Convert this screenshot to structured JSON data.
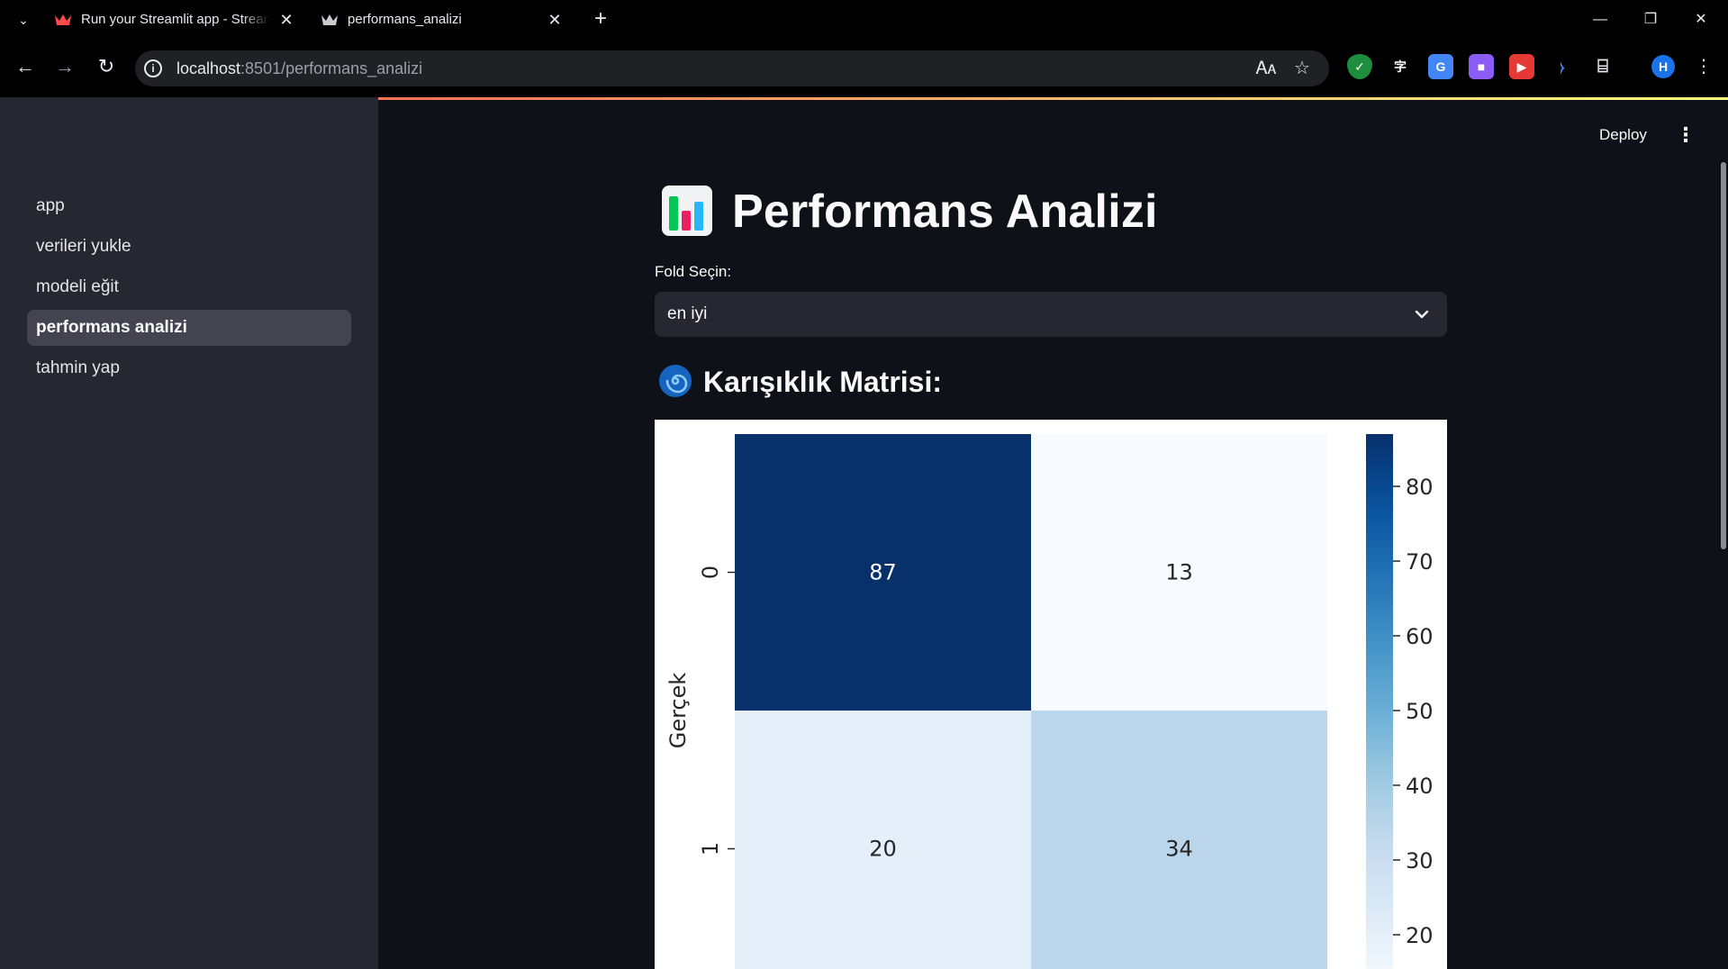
{
  "browser": {
    "tabs": [
      {
        "title": "Run your Streamlit app - Streamlit",
        "active": false
      },
      {
        "title": "performans_analizi",
        "active": true
      }
    ],
    "url_host": "localhost",
    "url_rest": ":8501/performans_analizi",
    "profile_initial": "H"
  },
  "header": {
    "deploy_label": "Deploy"
  },
  "sidebar": {
    "items": [
      {
        "label": "app",
        "active": false
      },
      {
        "label": "verileri yukle",
        "active": false
      },
      {
        "label": "modeli eğit",
        "active": false
      },
      {
        "label": "performans analizi",
        "active": true
      },
      {
        "label": "tahmin yap",
        "active": false
      }
    ]
  },
  "main": {
    "title": "Performans Analizi",
    "title_icon": "bar-chart-icon",
    "fold_label": "Fold Seçin:",
    "fold_value": "en iyi",
    "subheader": "Karışıklık Matrisi:",
    "subheader_icon": "cyclone-icon"
  },
  "colors": {
    "app_bg": "#0e1117",
    "sidebar_bg": "#262730",
    "accent": "#ff4b4b"
  },
  "chart_data": {
    "type": "heatmap",
    "title": "",
    "ylabel": "Gerçek",
    "xlabel": "",
    "y_categories": [
      "0",
      "1"
    ],
    "matrix": [
      [
        87,
        13
      ],
      [
        20,
        34
      ]
    ],
    "colormap": "Blues",
    "vmin": 13,
    "vmax": 87,
    "colorbar_ticks": [
      20,
      30,
      40,
      50,
      60,
      70,
      80
    ]
  }
}
